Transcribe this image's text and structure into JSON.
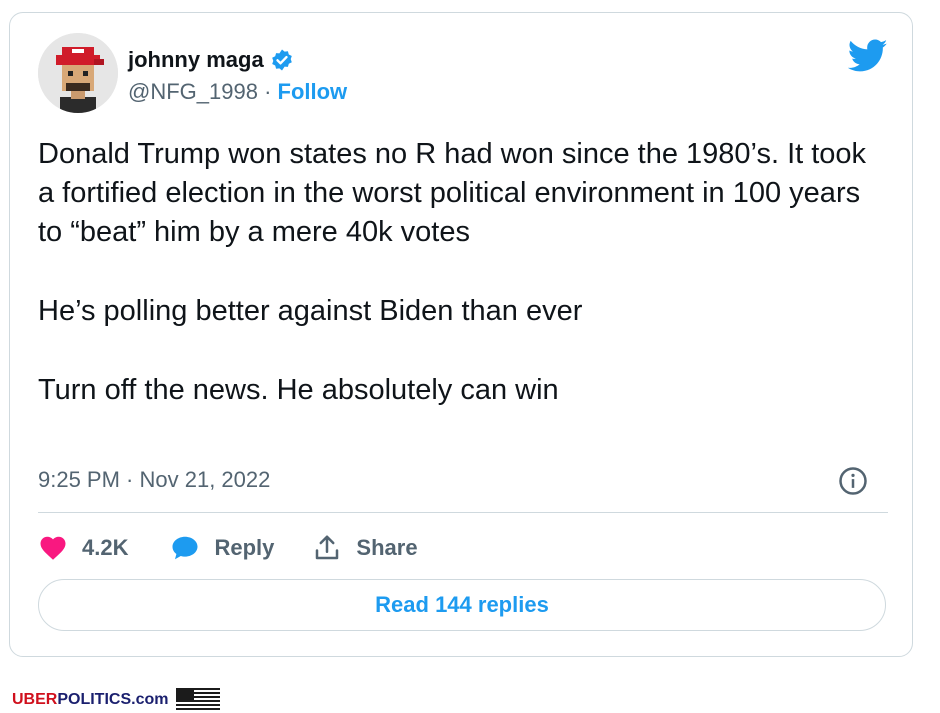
{
  "author": {
    "display_name": "johnny maga",
    "handle": "@NFG_1998",
    "separator": " · ",
    "follow_label": "Follow"
  },
  "tweet": {
    "paragraphs": [
      "Donald Trump won states no R had won since the 1980’s. It took a fortified election in the worst political environment in 100 years to “beat” him by a mere 40k votes",
      "He’s polling better against Biden than ever",
      "Turn off the news. He absolutely can win"
    ],
    "timestamp": "9:25 PM · Nov 21, 2022"
  },
  "actions": {
    "likes_count": "4.2K",
    "reply_label": "Reply",
    "share_label": "Share"
  },
  "read_replies_label": "Read 144 replies",
  "watermark": {
    "part1": "UBER",
    "part2": "POLITICS.com"
  },
  "colors": {
    "accent": "#1d9bf0",
    "like": "#f91880",
    "text": "#0f1419",
    "secondary": "#536471",
    "border": "#cfd9de"
  },
  "icons": [
    "verified-badge-icon",
    "twitter-bird-icon",
    "info-icon",
    "heart-icon",
    "reply-bubble-icon",
    "share-icon",
    "us-flag-icon"
  ]
}
